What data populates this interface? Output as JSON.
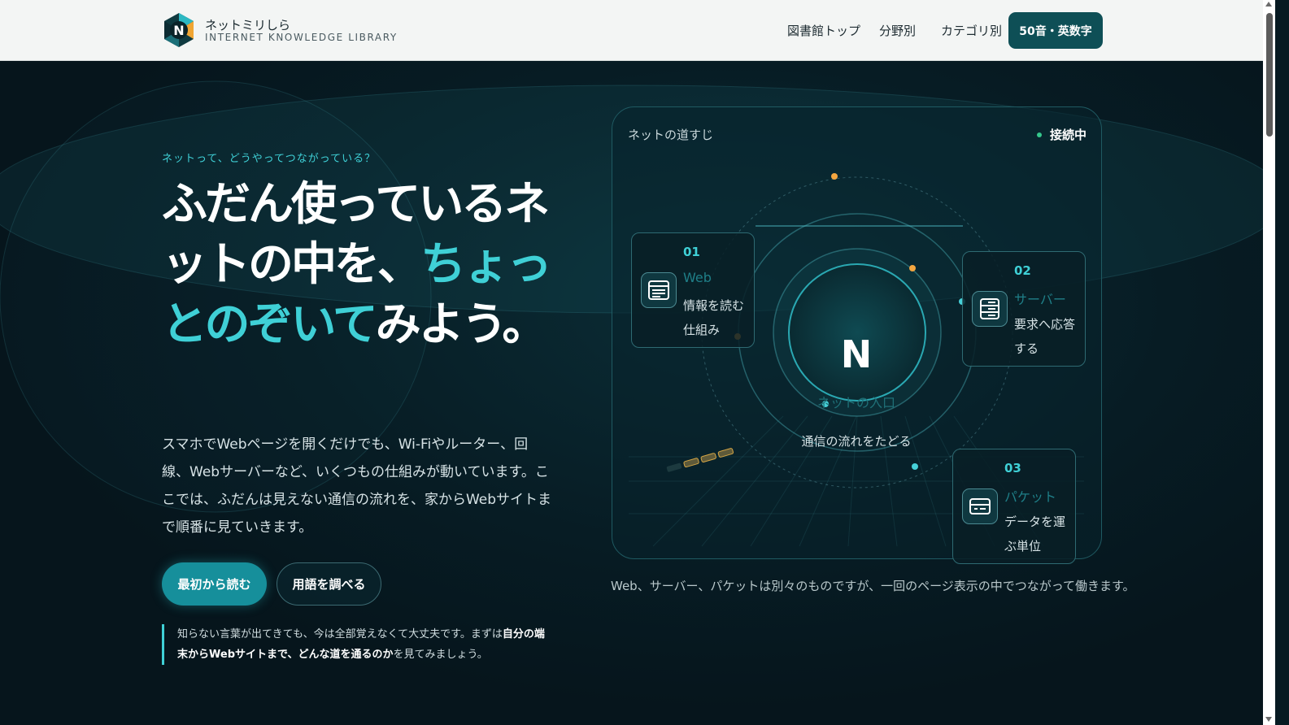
{
  "header": {
    "brand_jp": "ネットミリしら",
    "brand_en": "INTERNET KNOWLEDGE LIBRARY",
    "logo_letter": "N",
    "nav": [
      {
        "label": "図書館トップ"
      },
      {
        "label": "分野別"
      },
      {
        "label": "カテゴリ別"
      }
    ],
    "cta_label": "50音・英数字"
  },
  "hero": {
    "eyebrow": "ネットって、どうやってつながっている？",
    "title_part1": "ふだん使っているネットの中を、",
    "title_accent": "ちょっとのぞいて",
    "title_part2": "みよう。",
    "lead": "スマホでWebページを開くだけでも、Wi-Fiやルーター、回線、Webサーバーなど、いくつもの仕組みが動いています。ここでは、ふだんは見えない通信の流れを、家からWebサイトまで順番に見ていきます。",
    "primary_button": "最初から読む",
    "secondary_button": "用語を調べる",
    "note_part1": "知らない言葉が出てきても、今は全部覚えなくて大丈夫です。まずは",
    "note_bold": "自分の端末からWebサイトまで、どんな道を通るのか",
    "note_part2": "を見てみましょう。"
  },
  "panel": {
    "title": "ネットの道すじ",
    "status": "接続中",
    "core_letter": "N",
    "core_sub": "ネットの入口",
    "core_caption": "通信の流れをたどる",
    "cards": [
      {
        "num": "01",
        "name": "Web",
        "desc": "情報を読む仕組み",
        "icon": "browser-icon"
      },
      {
        "num": "02",
        "name": "サーバー",
        "desc": "要求へ応答する",
        "icon": "server-icon"
      },
      {
        "num": "03",
        "name": "パケット",
        "desc": "データを運ぶ単位",
        "icon": "packet-icon"
      }
    ],
    "caption": "Web、サーバー、パケットは別々のものですが、一回のページ表示の中でつながって働きます。"
  },
  "colors": {
    "accent": "#3fd0d6",
    "brand_dark": "#0e4f56",
    "primary_button": "#168f9b",
    "background": "#071a22"
  }
}
